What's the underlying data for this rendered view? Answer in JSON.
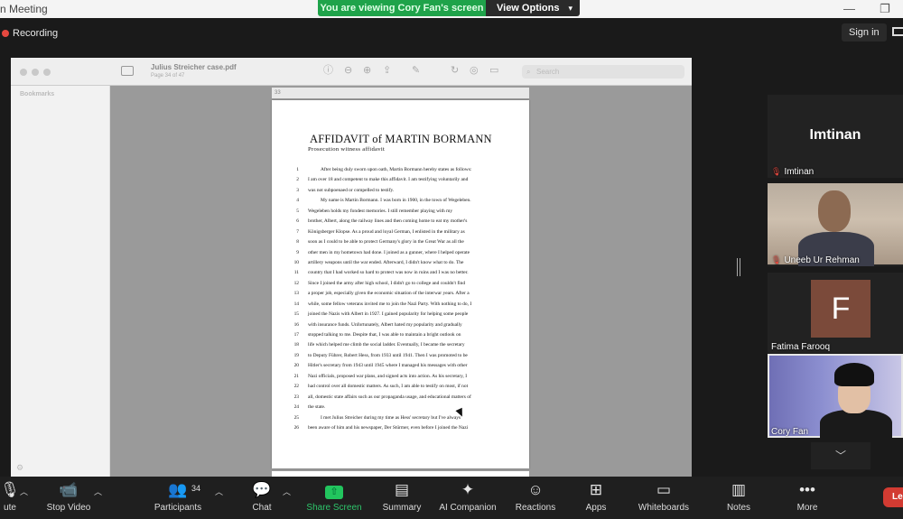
{
  "window": {
    "title_fragment": "n Meeting",
    "share_banner": "You are viewing Cory Fan's screen",
    "view_options": "View Options",
    "minimize_glyph": "—",
    "restore_glyph": "❐"
  },
  "header": {
    "recording_label": "Recording",
    "signin_label": "Sign in",
    "colors": {
      "recording": "#e5483f",
      "banner": "#1fa34a"
    }
  },
  "viewer": {
    "filename": "Julius Streicher case.pdf",
    "page_info": "Page 34 of 47",
    "search_placeholder": "Search",
    "bookmarks_label": "Bookmarks",
    "page_number_strip": "33",
    "toolbar_icons": [
      "sidebar-toggle-icon",
      "info-icon",
      "zoom-out-icon",
      "zoom-in-icon",
      "share-icon",
      "markup-pen-icon",
      "rotate-icon",
      "annotate-icon",
      "redact-icon"
    ],
    "document": {
      "title": "AFFIDAVIT of MARTIN BORMANN",
      "subtitle": "Prosecution witness affidavit",
      "lines": [
        {
          "n": "1",
          "text": "After being duly sworn upon oath, Martin Bormann hereby states as follows:",
          "indent": true
        },
        {
          "n": "2",
          "text": "I am over 18 and competent to make this affidavit. I am testifying voluntarily and",
          "indent": false
        },
        {
          "n": "3",
          "text": "was not subpoenaed or compelled to testify.",
          "indent": false
        },
        {
          "n": "4",
          "text": "My name is Martin Bormann. I was born in 1900, in the town of Wegeleben.",
          "indent": true
        },
        {
          "n": "5",
          "text": "Wegeleben holds my fondest memories. I still remember playing with my",
          "indent": false
        },
        {
          "n": "6",
          "text": "brother, Albert, along the railway lines and then coming home to eat my mother's",
          "indent": false
        },
        {
          "n": "7",
          "text": "Königsberger Klopse. As a proud and loyal German, I enlisted in the military as",
          "indent": false
        },
        {
          "n": "8",
          "text": "soon as I could to be able to protect Germany's glory in the Great War as all the",
          "indent": false
        },
        {
          "n": "9",
          "text": "other men in my hometown had done. I joined as a gunner, where I helped operate",
          "indent": false
        },
        {
          "n": "10",
          "text": "artillery weapons until the war ended. Afterward, I didn't know what to do. The",
          "indent": false
        },
        {
          "n": "11",
          "text": "country that I had worked so hard to protect was now in ruins and I was no better.",
          "indent": false
        },
        {
          "n": "12",
          "text": "Since I joined the army after high school, I didn't go to college and couldn't find",
          "indent": false
        },
        {
          "n": "13",
          "text": "a proper job, especially given the economic situation of the interwar years. After a",
          "indent": false
        },
        {
          "n": "14",
          "text": "while, some fellow veterans invited me to join the Nazi Party. With nothing to do, I",
          "indent": false
        },
        {
          "n": "15",
          "text": "joined the Nazis with Albert in 1927. I gained popularity for helping some people",
          "indent": false
        },
        {
          "n": "16",
          "text": "with insurance funds. Unfortunately, Albert hated my popularity and gradually",
          "indent": false
        },
        {
          "n": "17",
          "text": "stopped talking to me. Despite that, I was able to maintain a bright outlook on",
          "indent": false
        },
        {
          "n": "18",
          "text": "life which helped me climb the social ladder. Eventually, I became the secretary",
          "indent": false
        },
        {
          "n": "19",
          "text": "to Deputy Führer, Robert Hess, from 1933 until 1941. Then I was promoted to be",
          "indent": false
        },
        {
          "n": "20",
          "text": "Hitler's secretary from 1943 until 1945 where I managed his messages with other",
          "indent": false
        },
        {
          "n": "21",
          "text": "Nazi officials, proposed war plans, and signed acts into action. As his secretary, I",
          "indent": false
        },
        {
          "n": "22",
          "text": "had control over all domestic matters. As such, I am able to testify on most, if not",
          "indent": false
        },
        {
          "n": "23",
          "text": "all, domestic state affairs such as our propaganda usage, and educational matters of",
          "indent": false
        },
        {
          "n": "24",
          "text": "the state.",
          "indent": false
        },
        {
          "n": "25",
          "text": "I met Julius Streicher during my time as Hess' secretary but I've always",
          "indent": true
        },
        {
          "n": "26",
          "text": "been   aware of him and his newspaper, Der Stürmer, even before I joined the Nazi",
          "indent": false
        }
      ]
    }
  },
  "participants": [
    {
      "name": "Imtinan",
      "big_label": "Imtinan",
      "muted": true,
      "type": "name-card"
    },
    {
      "name": "Uneeb Ur Rehman",
      "muted": true,
      "type": "video"
    },
    {
      "name": "Fatima Farooq",
      "muted": false,
      "type": "avatar",
      "initial": "F",
      "avatar_color": "#7b4a3a"
    },
    {
      "name": "Cory Fan",
      "muted": false,
      "type": "video-active"
    }
  ],
  "toolbar": {
    "mute": "ute",
    "stop_video": "Stop Video",
    "participants": "Participants",
    "participants_count": "34",
    "chat": "Chat",
    "share_screen": "Share Screen",
    "summary": "Summary",
    "ai_companion": "AI Companion",
    "reactions": "Reactions",
    "apps": "Apps",
    "whiteboards": "Whiteboards",
    "notes": "Notes",
    "more": "More",
    "leave": "Le",
    "share_color": "#22c55e",
    "leave_color": "#d23b32"
  }
}
